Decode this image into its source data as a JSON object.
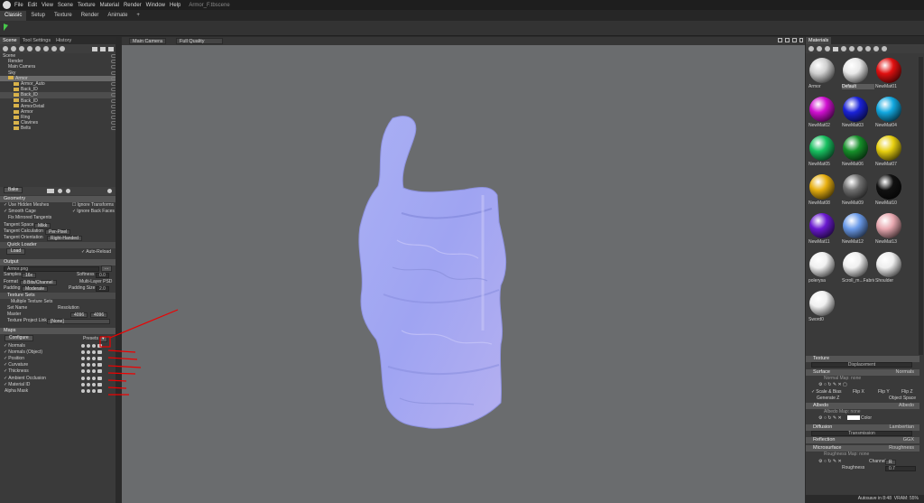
{
  "titlebar": {
    "menus": [
      "File",
      "Edit",
      "View",
      "Scene",
      "Texture",
      "Material",
      "Render",
      "Window",
      "Help"
    ],
    "doc": "Armor_F.tbscene"
  },
  "tabs": [
    "Classic",
    "Setup",
    "Texture",
    "Render",
    "Animate",
    "+"
  ],
  "left": {
    "tabs": [
      "Scene",
      "Tool Settings",
      "History"
    ],
    "tree": [
      {
        "label": "Scene",
        "indent": 0,
        "folder": false,
        "cls": ""
      },
      {
        "label": "Render",
        "indent": 1,
        "folder": false,
        "cls": ""
      },
      {
        "label": "Main Camera",
        "indent": 1,
        "folder": false,
        "cls": ""
      },
      {
        "label": "Sky",
        "indent": 1,
        "folder": false,
        "cls": ""
      },
      {
        "label": "Armor",
        "indent": 1,
        "folder": true,
        "cls": "sel"
      },
      {
        "label": "Armor_Auto",
        "indent": 2,
        "folder": true,
        "cls": ""
      },
      {
        "label": "Back_ID",
        "indent": 2,
        "folder": true,
        "cls": ""
      },
      {
        "label": "Back_ID",
        "indent": 2,
        "folder": true,
        "cls": "seld"
      },
      {
        "label": "Back_ID",
        "indent": 2,
        "folder": true,
        "cls": ""
      },
      {
        "label": "ArmorDetail",
        "indent": 2,
        "folder": true,
        "cls": ""
      },
      {
        "label": "Armor",
        "indent": 2,
        "folder": true,
        "cls": ""
      },
      {
        "label": "Ring",
        "indent": 2,
        "folder": true,
        "cls": ""
      },
      {
        "label": "Clavines",
        "indent": 2,
        "folder": true,
        "cls": ""
      },
      {
        "label": "Belts",
        "indent": 2,
        "folder": true,
        "cls": ""
      }
    ],
    "bake": "Bake",
    "geometry": {
      "title": "Geometry",
      "use_hidden": "Use Hidden Meshes",
      "ignore_transforms": "Ignore Transforms",
      "smooth_cage": "Smooth Cage",
      "ignore_back": "Ignore Back Faces",
      "fix_mirrored": "Fix Mirrored Tangents",
      "tangent_space": "Tangent Space",
      "tangent_space_val": "Mikk",
      "tangent_calc": "Tangent Calculation",
      "tangent_calc_val": "Per-Pixel",
      "tangent_orient": "Tangent Orientation",
      "tangent_orient_val": "Right-Handed"
    },
    "quick_loader": {
      "title": "Quick Loader",
      "load": "Load",
      "auto_reload": "Auto-Reload"
    },
    "output": {
      "title": "Output",
      "file": "Armor.png",
      "samples": "Samples",
      "samples_val": "16x",
      "softness": "Softness",
      "softness_val": "0.0",
      "format": "Format",
      "format_val": "8 Bits/Channel",
      "multilayer": "Multi-Layer PSD",
      "padding": "Padding",
      "padding_val": "Moderate",
      "padding_size": "Padding Size",
      "padding_size_val": "2.0"
    },
    "texture_sets": {
      "title": "Texture Sets",
      "multi": "Multiple Texture Sets",
      "set_name": "Set Name",
      "resolution": "Resolution",
      "master": "Master",
      "res1": "4096",
      "res2": "4096",
      "project_link": "Texture Project Link",
      "project_link_val": "[None]"
    },
    "maps": {
      "title": "Maps",
      "configure": "Configure",
      "presets": "Presets",
      "items": [
        "Normals",
        "Normals (Object)",
        "Position",
        "Curvature",
        "Thickness",
        "Ambient Occlusion",
        "Material ID",
        "Alpha Mask"
      ]
    }
  },
  "viewport": {
    "camera": "Main Camera",
    "quality": "Full Quality"
  },
  "right": {
    "tab": "Materials",
    "materials": [
      {
        "name": "Armor",
        "color": "#d0d0d0"
      },
      {
        "name": "Default",
        "color": "#e8e8e8"
      },
      {
        "name": "NewMat01",
        "color": "#e01010"
      },
      {
        "name": "NewMat02",
        "color": "#d010d0"
      },
      {
        "name": "NewMat03",
        "color": "#1a22d8"
      },
      {
        "name": "NewMat04",
        "color": "#12a8e0"
      },
      {
        "name": "NewMat05",
        "color": "#18c060"
      },
      {
        "name": "NewMat06",
        "color": "#16902a"
      },
      {
        "name": "NewMat07",
        "color": "#e8d010"
      },
      {
        "name": "NewMat08",
        "color": "#e8b010"
      },
      {
        "name": "NewMat09",
        "color": "#707070"
      },
      {
        "name": "NewMat10",
        "color": "#111111"
      },
      {
        "name": "NewMat11",
        "color": "#6a1ad0"
      },
      {
        "name": "NewMat12",
        "color": "#6a9ae8"
      },
      {
        "name": "NewMat13",
        "color": "#e8a8b0"
      },
      {
        "name": "polerysa",
        "color": "#f0f0f0"
      },
      {
        "name": "Scroll_m...Fabric",
        "color": "#f0f0f0"
      },
      {
        "name": "Shoulder",
        "color": "#eeeeee"
      },
      {
        "name": "Sword0",
        "color": "#f0f0f0"
      }
    ],
    "props": {
      "texture": "Texture",
      "displacement": "Displacement",
      "surface": "Surface",
      "surface_val": "Normals",
      "normal_map": "Normal Map:",
      "none": "none",
      "scale_bias": "Scale & Bias",
      "flip_x": "Flip X",
      "flip_y": "Flip Y",
      "flip_z": "Flip Z",
      "generate_z": "Generate Z",
      "object_space": "Object Space",
      "albedo": "Albedo",
      "albedo_val": "Albedo",
      "albedo_map": "Albedo Map:",
      "color": "Color",
      "diffusion": "Diffusion",
      "diffusion_val": "Lambertian",
      "transmission": "Transmission",
      "reflection": "Reflection",
      "reflection_val": "GGX",
      "microsurface": "Microsurface",
      "microsurface_val": "Roughness",
      "roughness_map": "Roughness Map:",
      "channel": "Channel",
      "channel_val": "R",
      "roughness": "Roughness",
      "roughness_num": "0.7"
    }
  },
  "status": {
    "autosave": "Autosave in 8:48",
    "vram": "VRAM: 55%"
  }
}
